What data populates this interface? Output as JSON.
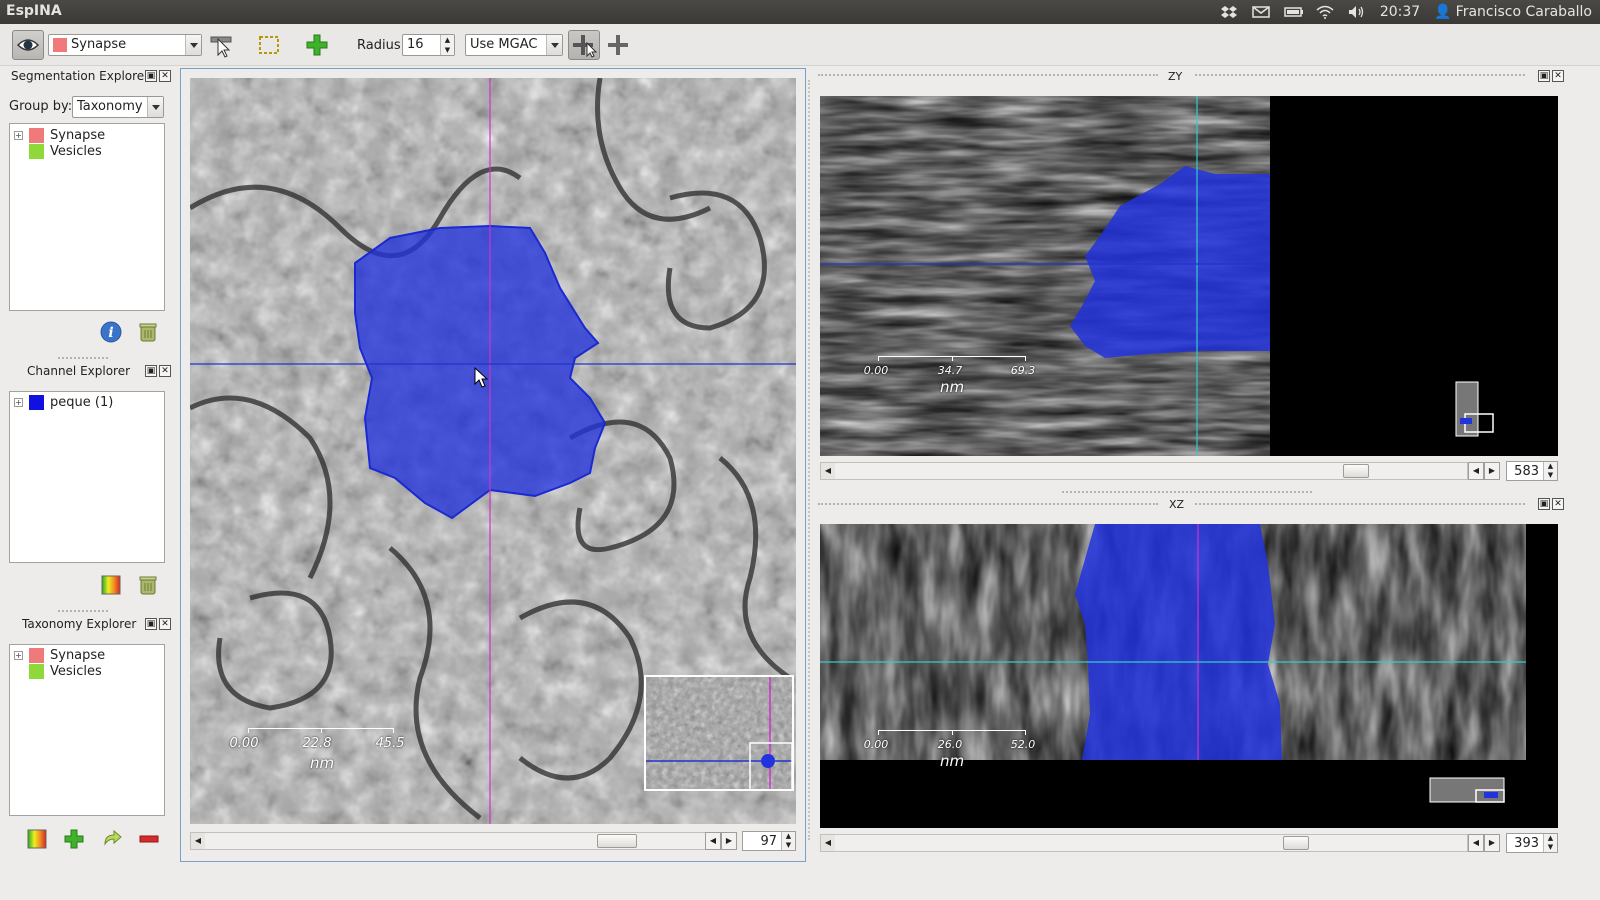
{
  "app": {
    "title": "EspINA"
  },
  "tray": {
    "time": "20:37",
    "user": "Francisco Caraballo"
  },
  "toolbar": {
    "segmentation_combo": "Synapse",
    "segmentation_color": "#f07a7a",
    "radius_label": "Radius",
    "radius_value": "16",
    "method_combo": "Use MGAC"
  },
  "segmentation_explorer": {
    "title": "Segmentation Explorer",
    "group_by_label": "Group by:",
    "group_by_value": "Taxonomy",
    "items": [
      {
        "label": "Synapse",
        "color": "#f07a7a"
      },
      {
        "label": "Vesicles",
        "color": "#8ed83a"
      }
    ]
  },
  "channel_explorer": {
    "title": "Channel Explorer",
    "items": [
      {
        "label": "peque (1)",
        "color": "#1010e0"
      }
    ]
  },
  "taxonomy_explorer": {
    "title": "Taxonomy Explorer",
    "items": [
      {
        "label": "Synapse",
        "color": "#f07a7a"
      },
      {
        "label": "Vesicles",
        "color": "#8ed83a"
      }
    ]
  },
  "xy_view": {
    "scale": {
      "ticks": [
        "0.00",
        "22.8",
        "45.5"
      ],
      "unit": "nm"
    },
    "slice": "97"
  },
  "zy_view": {
    "title": "ZY",
    "scale": {
      "ticks": [
        "0.00",
        "34.7",
        "69.3"
      ],
      "unit": "nm"
    },
    "slice": "583"
  },
  "xz_view": {
    "title": "XZ",
    "scale": {
      "ticks": [
        "0.00",
        "26.0",
        "52.0"
      ],
      "unit": "nm"
    },
    "slice": "393"
  },
  "colors": {
    "segmentation_overlay": "#2233dd",
    "crosshair_magenta": "#cc33cc",
    "crosshair_blue": "#2233cc",
    "crosshair_cyan": "#33cccc"
  }
}
